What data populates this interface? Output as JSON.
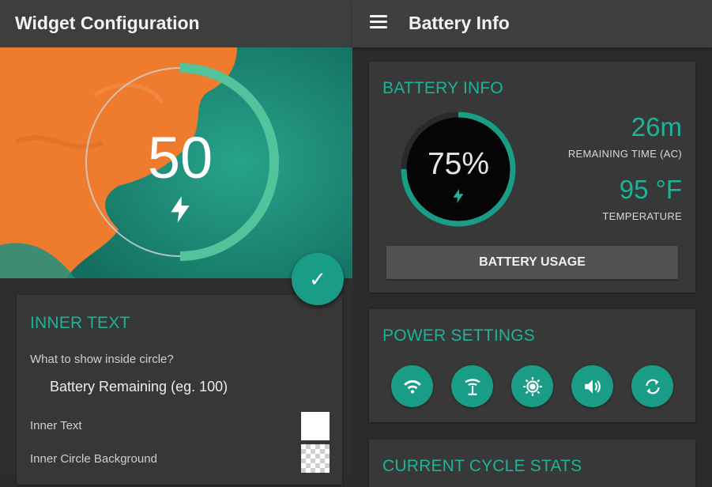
{
  "left_appbar": {
    "title": "Widget Configuration"
  },
  "preview": {
    "value": "50",
    "level_percent": 50,
    "icon": "bolt-icon"
  },
  "fab": {
    "icon": "check-icon",
    "glyph": "✓"
  },
  "inner_text": {
    "title": "INNER TEXT",
    "question": "What to show inside circle?",
    "answer": "Battery Remaining (eg. 100)",
    "rows": [
      {
        "label": "Inner Text",
        "swatch": "white"
      },
      {
        "label": "Inner Circle Background",
        "swatch": "transparent"
      }
    ]
  },
  "right_appbar": {
    "title": "Battery Info",
    "menu_icon": "menu-icon"
  },
  "battery_info": {
    "title": "BATTERY INFO",
    "percent_text": "75%",
    "percent_value": 75,
    "remaining_time": "26m",
    "remaining_label": "REMAINING TIME (AC)",
    "temperature": "95 °F",
    "temperature_label": "TEMPERATURE",
    "usage_button": "BATTERY USAGE"
  },
  "power_settings": {
    "title": "POWER SETTINGS",
    "buttons": [
      "wifi-icon",
      "hotspot-icon",
      "brightness-icon",
      "volume-icon",
      "sync-icon"
    ]
  },
  "cycle_stats": {
    "title": "CURRENT CYCLE STATS"
  },
  "colors": {
    "accent": "#1db399",
    "button": "#199d86",
    "orange": "#f07a2c",
    "teal_bg": "#1f8f7c"
  }
}
